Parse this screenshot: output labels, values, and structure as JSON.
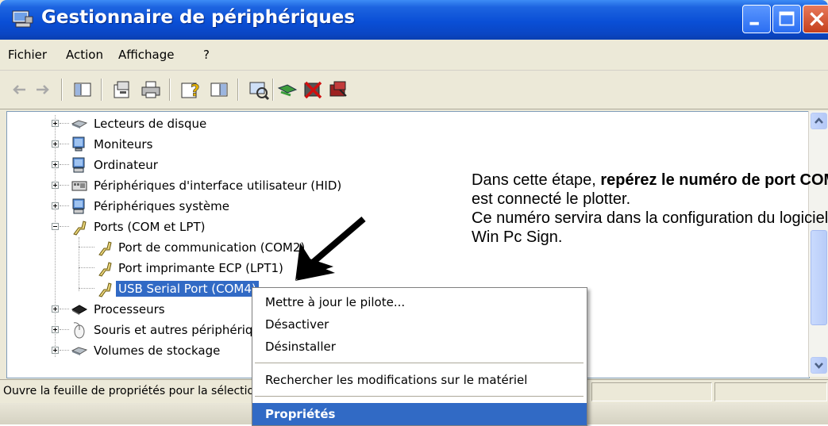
{
  "window": {
    "title": "Gestionnaire de périphériques",
    "icon": "device-manager-icon"
  },
  "menubar": {
    "items": [
      "Fichier",
      "Action",
      "Affichage",
      "?"
    ]
  },
  "toolbar": {
    "buttons": [
      "back-arrow-icon",
      "forward-arrow-icon",
      "show-hide-console-icon",
      "properties-icon",
      "print-icon",
      "help-icon",
      "show-pane-icon",
      "scan-hardware-icon",
      "update-driver-icon",
      "disable-device-icon",
      "uninstall-device-icon"
    ]
  },
  "tree": {
    "nodes": [
      {
        "label": "Lecteurs de disque",
        "icon": "disk-drive-icon",
        "expander": "plus"
      },
      {
        "label": "Moniteurs",
        "icon": "monitor-icon",
        "expander": "plus"
      },
      {
        "label": "Ordinateur",
        "icon": "computer-icon",
        "expander": "plus"
      },
      {
        "label": "Périphériques d'interface utilisateur (HID)",
        "icon": "hid-icon",
        "expander": "plus"
      },
      {
        "label": "Périphériques système",
        "icon": "system-devices-icon",
        "expander": "plus"
      },
      {
        "label": "Ports (COM et LPT)",
        "icon": "ports-icon",
        "expander": "minus"
      },
      {
        "label": "Port de communication (COM2)",
        "icon": "port-icon",
        "child": true
      },
      {
        "label": "Port imprimante ECP (LPT1)",
        "icon": "port-icon",
        "child": true
      },
      {
        "label": "USB Serial Port (COM4)",
        "icon": "port-icon",
        "child": true,
        "selected": true
      },
      {
        "label": "Processeurs",
        "icon": "processor-icon",
        "expander": "plus"
      },
      {
        "label": "Souris et autres périphériques de pointage",
        "icon": "mouse-icon",
        "expander": "plus"
      },
      {
        "label": "Volumes de stockage",
        "icon": "storage-volume-icon",
        "expander": "plus"
      }
    ]
  },
  "context_menu": {
    "items": [
      {
        "label": "Mettre à jour le pilote..."
      },
      {
        "label": "Désactiver"
      },
      {
        "label": "Désinstaller"
      },
      {
        "label": "Rechercher les modifications sur le matériel"
      },
      {
        "label": "Propriétés",
        "bold": true,
        "highlighted": true
      }
    ]
  },
  "statusbar": {
    "text": "Ouvre la feuille de propriétés pour la sélection en cours."
  },
  "annotation": {
    "line1_normal": "Dans cette étape, ",
    "line1_bold": "repérez le numéro de port COM sur lequel",
    "line2": "est connecté le plotter.",
    "line3": "Ce numéro servira dans la configuration du logiciel",
    "line4": "Win Pc Sign."
  },
  "colors": {
    "titlebar": "#0a4fd6",
    "selection": "#316ac5",
    "window_bg": "#ece9d8"
  }
}
